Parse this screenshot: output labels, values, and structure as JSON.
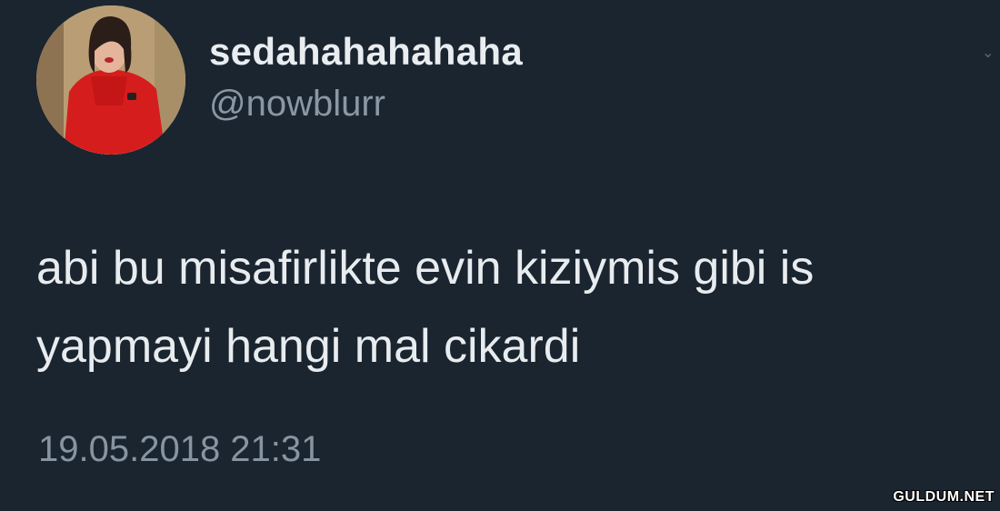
{
  "tweet": {
    "display_name": "sedahahahahaha",
    "handle": "@nowblurr",
    "text_lines": [
      "abi bu misafirlikte evin kiziymis gibi is",
      "yapmayi hangi mal cikardi"
    ],
    "timestamp": "19.05.2018 21:31"
  },
  "watermark": "GULDUM.NET",
  "colors": {
    "background": "#1b2530",
    "name": "#e9edf0",
    "secondary_text": "#8a98a5",
    "avatar_accent": "#d81e1e"
  },
  "icons": {
    "caret": "chevron-down-icon"
  }
}
